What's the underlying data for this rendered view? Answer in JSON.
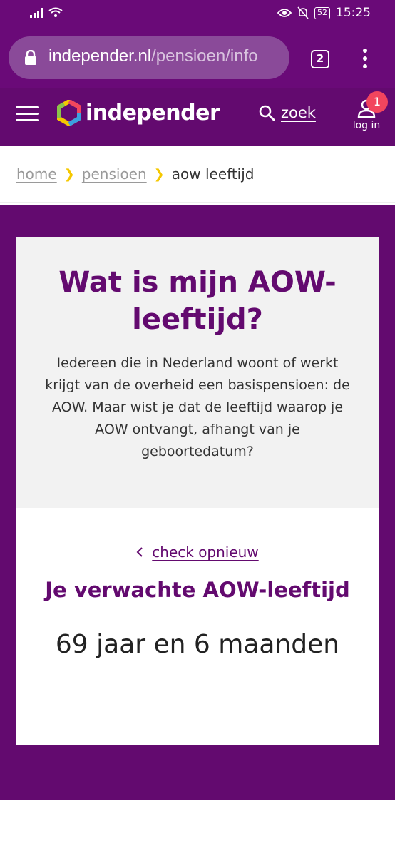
{
  "status_bar": {
    "time": "15:25",
    "battery": "52"
  },
  "browser": {
    "url_domain": "independer.nl",
    "url_path": "/pensioen/info",
    "tab_count": "2"
  },
  "header": {
    "logo_text": "independer",
    "search_label": "zoek",
    "login_label": "log in",
    "notification_count": "1"
  },
  "breadcrumb": {
    "items": [
      "home",
      "pensioen"
    ],
    "current": "aow leeftijd"
  },
  "intro": {
    "title": "Wat is mijn AOW-leeftijd?",
    "description": "Iedereen die in Nederland woont of werkt krijgt van de overheid een basispensioen: de AOW. Maar wist je dat de leeftijd waarop je AOW ontvangt, afhangt van je geboortedatum?"
  },
  "result": {
    "recheck_label": "check opnieuw",
    "title": "Je verwachte AOW-leeftijd",
    "value": "69 jaar en 6 maanden"
  },
  "colors": {
    "brand_purple": "#630a6f",
    "accent_yellow": "#f5c800",
    "badge_red": "#f2455e"
  }
}
